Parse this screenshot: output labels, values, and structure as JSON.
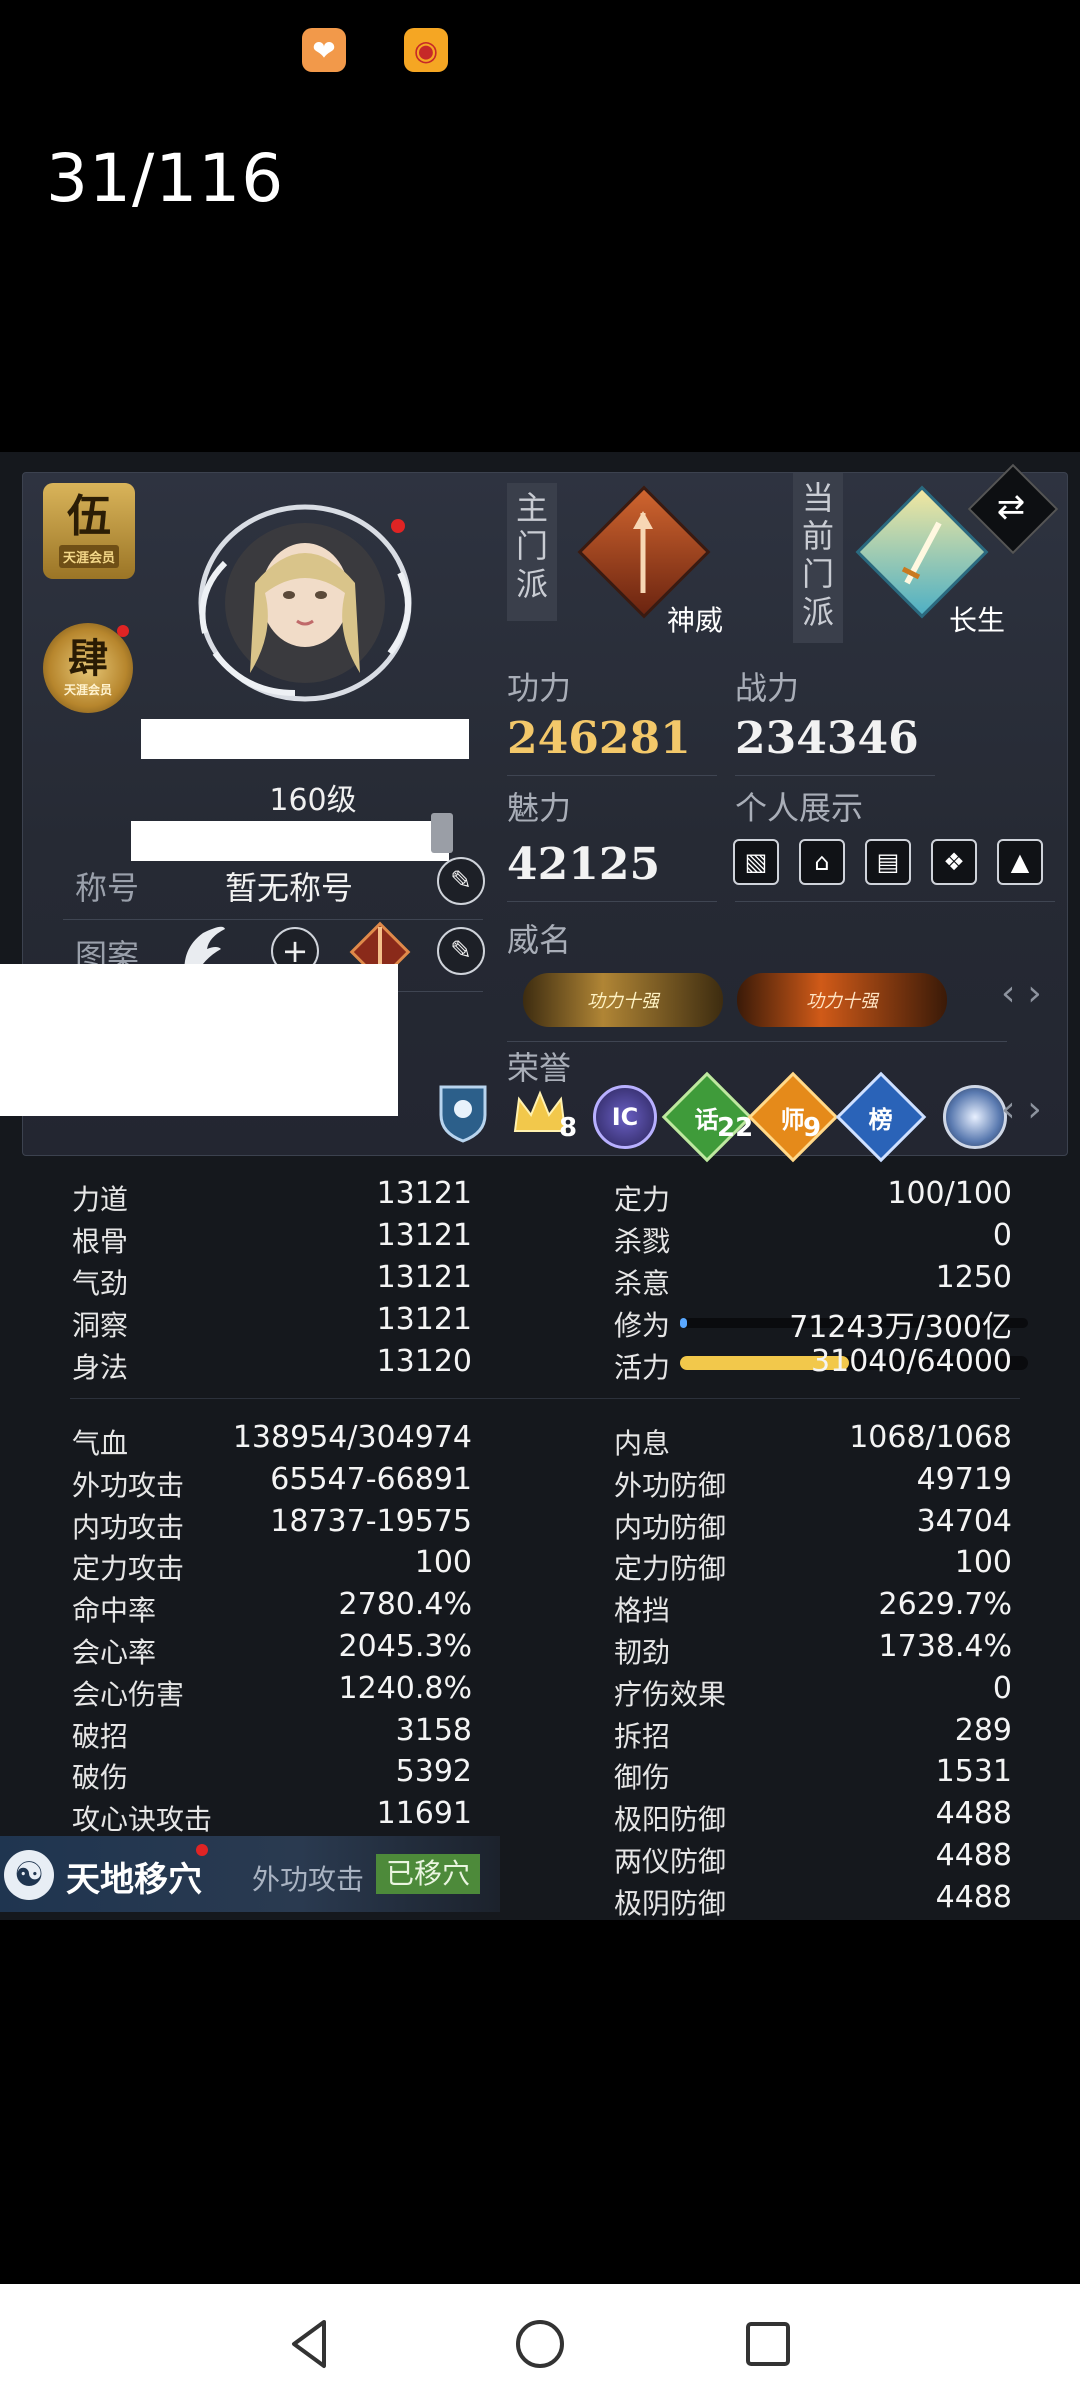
{
  "top": {
    "counter": "31/116",
    "icons": [
      "heart-app-icon",
      "weibo-icon"
    ]
  },
  "colors": {
    "gold": "#f3c86a",
    "panel_bg": "#15181d",
    "upper_bg": "#2a2e39",
    "activity_bar": "#f2c84b",
    "cultivation_bar": "#5aa8ff",
    "moved_badge": "#4d8a3a"
  },
  "character": {
    "badge_square": {
      "main": "伍",
      "sub": "天涯会员"
    },
    "badge_round": {
      "main": "肆",
      "sub": "天涯会员"
    },
    "level": "160级",
    "title_label": "称号",
    "title_value": "暂无称号",
    "pattern_label": "图案"
  },
  "sect": {
    "main_label": "主门派",
    "main_name": "神威",
    "current_label": "当前门派",
    "current_name": "长生"
  },
  "scores": {
    "gongli_label": "功力",
    "gongli_value": "246281",
    "zhanli_label": "战力",
    "zhanli_value": "234346",
    "meili_label": "魅力",
    "meili_value": "42125",
    "display_label": "个人展示"
  },
  "fame": {
    "label": "威名",
    "items": [
      "功力十强",
      "功力十强"
    ]
  },
  "honor": {
    "label": "荣誉",
    "items": [
      {
        "icon": "crown-icon",
        "count": "8"
      },
      {
        "icon": "ic-medal-icon",
        "text": "IC"
      },
      {
        "icon": "talk-medal-icon",
        "text": "话",
        "count": "22"
      },
      {
        "icon": "master-medal-icon",
        "text": "师",
        "count": "9"
      },
      {
        "icon": "rank-medal-icon",
        "text": "榜"
      },
      {
        "icon": "orb-medal-icon"
      }
    ]
  },
  "attributes": {
    "left": [
      {
        "label": "力道",
        "value": "13121"
      },
      {
        "label": "根骨",
        "value": "13121"
      },
      {
        "label": "气劲",
        "value": "13121"
      },
      {
        "label": "洞察",
        "value": "13121"
      },
      {
        "label": "身法",
        "value": "13120"
      }
    ],
    "right": [
      {
        "label": "定力",
        "value": "100/100"
      },
      {
        "label": "杀戮",
        "value": "0"
      },
      {
        "label": "杀意",
        "value": "1250"
      },
      {
        "label": "修为",
        "value": "71243万/300亿",
        "fill": 0.02
      },
      {
        "label": "活力",
        "value": "31040/64000",
        "fill": 0.485
      }
    ]
  },
  "combat": {
    "left": [
      {
        "label": "气血",
        "value": "138954/304974"
      },
      {
        "label": "外功攻击",
        "value": "65547-66891"
      },
      {
        "label": "内功攻击",
        "value": "18737-19575"
      },
      {
        "label": "定力攻击",
        "value": "100"
      },
      {
        "label": "命中率",
        "value": "2780.4%"
      },
      {
        "label": "会心率",
        "value": "2045.3%"
      },
      {
        "label": "会心伤害",
        "value": "1240.8%"
      },
      {
        "label": "破招",
        "value": "3158"
      },
      {
        "label": "破伤",
        "value": "5392"
      },
      {
        "label": "攻心诀攻击",
        "value": "11691"
      }
    ],
    "right": [
      {
        "label": "内息",
        "value": "1068/1068"
      },
      {
        "label": "外功防御",
        "value": "49719"
      },
      {
        "label": "内功防御",
        "value": "34704"
      },
      {
        "label": "定力防御",
        "value": "100"
      },
      {
        "label": "格挡",
        "value": "2629.7%"
      },
      {
        "label": "韧劲",
        "value": "1738.4%"
      },
      {
        "label": "疗伤效果",
        "value": "0"
      },
      {
        "label": "拆招",
        "value": "289"
      },
      {
        "label": "御伤",
        "value": "1531"
      },
      {
        "label": "极阳防御",
        "value": "4488"
      },
      {
        "label": "两仪防御",
        "value": "4488"
      },
      {
        "label": "极阴防御",
        "value": "4488"
      }
    ]
  },
  "skill_bar": {
    "name": "天地移穴",
    "attack_type": "外功攻击",
    "status": "已移穴"
  }
}
